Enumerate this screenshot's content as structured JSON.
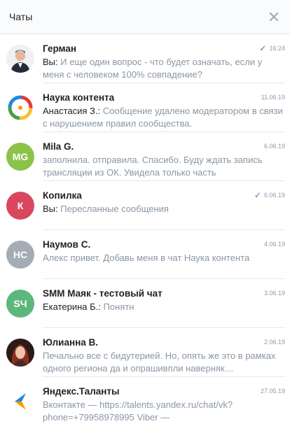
{
  "header": {
    "title": "Чаты"
  },
  "chats": [
    {
      "name": "Герман",
      "date": "16:24",
      "read": true,
      "prefix": "Вы:",
      "text": "И еще один вопрос - что будет означать, если у меня с человеком 100% совпадение?",
      "avatar": "photo-man",
      "initials": ""
    },
    {
      "name": "Наука контента",
      "date": "11.06.19",
      "read": false,
      "prefix": "Анастасия З.:",
      "text": "Сообщение удалено модератором в связи с нарушением правил сообщества.",
      "avatar": "logo-ring",
      "initials": ""
    },
    {
      "name": "Mila G.",
      "date": "6.06.19",
      "read": false,
      "prefix": "",
      "text": "заполнила. отправила. Спасибо. Буду ждать запись трансляции из ОК. Увидела только часть",
      "avatar": "initials",
      "initials": "MG",
      "color": "#8bc34a"
    },
    {
      "name": "Копилка",
      "date": "6.06.19",
      "read": true,
      "prefix": "Вы:",
      "text": "Пересланные сообщения",
      "avatar": "initials",
      "initials": "К",
      "color": "#d9475e"
    },
    {
      "name": "Наумов С.",
      "date": "4.06.19",
      "read": false,
      "prefix": "",
      "text": "Алекс привет. Добавь меня в чат Наука контента",
      "avatar": "initials",
      "initials": "НС",
      "color": "#a4acb6"
    },
    {
      "name": "SMM Маяк - тестовый чат",
      "date": "3.06.19",
      "read": false,
      "prefix": "Екатерина Б.:",
      "text": "Понятн",
      "avatar": "initials",
      "initials": "SЧ",
      "color": "#5cb87a"
    },
    {
      "name": "Юлианна В.",
      "date": "2.06.19",
      "read": false,
      "prefix": "",
      "text": "Печально все с бидутерией. Но, опять же это в рамках одного региона да и опрашивпли наверняк…",
      "avatar": "photo-woman",
      "initials": ""
    },
    {
      "name": "Яндекс.Таланты",
      "date": "27.05.19",
      "read": false,
      "prefix": "",
      "text": "Вконтакте — https://talents.yandex.ru/chat/vk?phone=+79958978995 Viber —",
      "avatar": "logo-arrow",
      "initials": ""
    }
  ],
  "colors": {
    "accent": "#4a76a8",
    "muted": "#8a96a3",
    "divider": "#e7e8ec"
  },
  "icons": {
    "close": "close-icon",
    "read": "double-check-icon"
  }
}
